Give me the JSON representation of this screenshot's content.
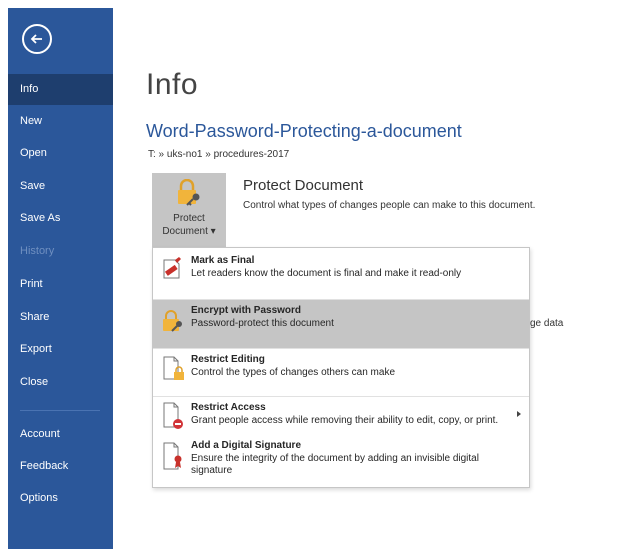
{
  "sidebar": {
    "back_label": "Back",
    "items": [
      {
        "label": "Info",
        "state": "active"
      },
      {
        "label": "New",
        "state": "normal"
      },
      {
        "label": "Open",
        "state": "normal"
      },
      {
        "label": "Save",
        "state": "normal"
      },
      {
        "label": "Save As",
        "state": "normal"
      },
      {
        "label": "History",
        "state": "disabled"
      },
      {
        "label": "Print",
        "state": "normal"
      },
      {
        "label": "Share",
        "state": "normal"
      },
      {
        "label": "Export",
        "state": "normal"
      },
      {
        "label": "Close",
        "state": "normal"
      },
      {
        "label": "Account",
        "state": "normal"
      },
      {
        "label": "Feedback",
        "state": "normal"
      },
      {
        "label": "Options",
        "state": "normal"
      }
    ]
  },
  "main": {
    "page_title": "Info",
    "document_title": "Word-Password-Protecting-a-document",
    "path": "T: » uks-no1 » procedures-2017",
    "protect": {
      "button_line1": "Protect",
      "button_line2": "Document ▾",
      "heading": "Protect Document",
      "description": "Control what types of changes people can make to this document.",
      "icon": "lock-key-icon"
    },
    "partial_text": "ge data"
  },
  "dropdown": {
    "items": [
      {
        "title": "Mark as Final",
        "description": "Let readers know the document is final and make it read-only",
        "icon": "mark-final-icon"
      },
      {
        "title": "Encrypt with Password",
        "description": "Password-protect this document",
        "icon": "lock-key-icon",
        "highlighted": true
      },
      {
        "title": "Restrict Editing",
        "description": "Control the types of changes others can make",
        "icon": "document-lock-icon"
      },
      {
        "title": "Restrict Access",
        "description": "Grant people access while removing their ability to edit, copy, or print.",
        "icon": "document-restrict-icon",
        "has_submenu": true
      },
      {
        "title": "Add a Digital Signature",
        "description": "Ensure the integrity of the document by adding an invisible digital signature",
        "icon": "document-signature-icon"
      }
    ]
  },
  "colors": {
    "sidebar": "#2b579a",
    "sidebar_active": "#1e3e6e",
    "title_blue": "#2b579a",
    "highlight": "#c5c5c5"
  }
}
